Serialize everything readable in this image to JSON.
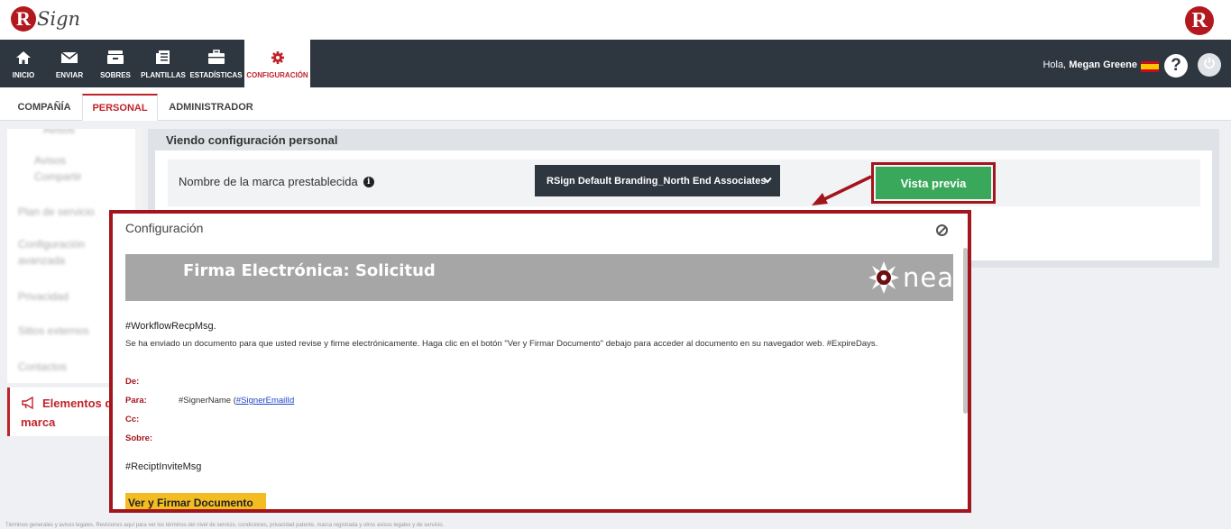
{
  "brand": {
    "logo_text": "Sign",
    "logo_letter": "R"
  },
  "nav": {
    "items": [
      {
        "label": "INICIO",
        "icon": "home-icon"
      },
      {
        "label": "ENVIAR",
        "icon": "envelope-icon"
      },
      {
        "label": "SOBRES",
        "icon": "inbox-icon"
      },
      {
        "label": "PLANTILLAS",
        "icon": "templates-icon"
      },
      {
        "label": "ESTADÍSTICAS",
        "icon": "briefcase-icon"
      },
      {
        "label": "CONFIGURACIÓN",
        "icon": "gear-icon"
      }
    ],
    "greeting": "Hola,",
    "user_name": "Megan Greene",
    "help_label": "?"
  },
  "tabs": [
    {
      "label": "COMPAÑÍA"
    },
    {
      "label": "PERSONAL"
    },
    {
      "label": "ADMINISTRADOR"
    }
  ],
  "sidebar": {
    "items": [
      {
        "label": "Avisos"
      },
      {
        "label": "Avisos"
      },
      {
        "label": "Compartir"
      },
      {
        "label": "Plan de servicio"
      },
      {
        "label": "Configuración"
      },
      {
        "label": "avanzada"
      },
      {
        "label": "Privacidad"
      },
      {
        "label": "Sitios externos"
      },
      {
        "label": "Contactos"
      }
    ],
    "active_line1": "Elementos de",
    "active_line2": "marca"
  },
  "panel": {
    "title": "Viendo configuración personal",
    "brand_label": "Nombre de la marca prestablecida",
    "info_icon": "i",
    "brand_selected": "RSign Default Branding_North End Associates",
    "preview_button": "Vista previa"
  },
  "modal": {
    "title": "Configuración",
    "banner_title": "Firma Electrónica: Solicitud",
    "banner_logo": "nea",
    "workflow_msg": "#WorkflowRecpMsg.",
    "body_msg": "Se ha enviado un documento para que usted revise y firme electrónicamente. Haga clic en el botón \"Ver y Firmar Documento\" debajo para acceder al documento en su navegador web. #ExpireDays.",
    "from_label": "De:",
    "to_label": "Para:",
    "to_name": "#SignerName (",
    "to_email": "#SignerEmailId",
    "cc_label": "Cc:",
    "subject_label": "Sobre:",
    "invite_msg": "#ReciptInviteMsg",
    "sign_button": "Ver y Firmar Documento"
  },
  "footer": {
    "text": "Términos generales y avisos legales. Revisiones aquí para ver los términos del nivel de servicio, condiciones, privacidad patente, marca registrada y otros avisos legales y de servicio."
  },
  "colors": {
    "accent": "#c0242b",
    "nav_bg": "#2e3640",
    "preview_green": "#3aa85b",
    "highlight_red": "#a3151c",
    "sign_yellow": "#f3bd22"
  }
}
